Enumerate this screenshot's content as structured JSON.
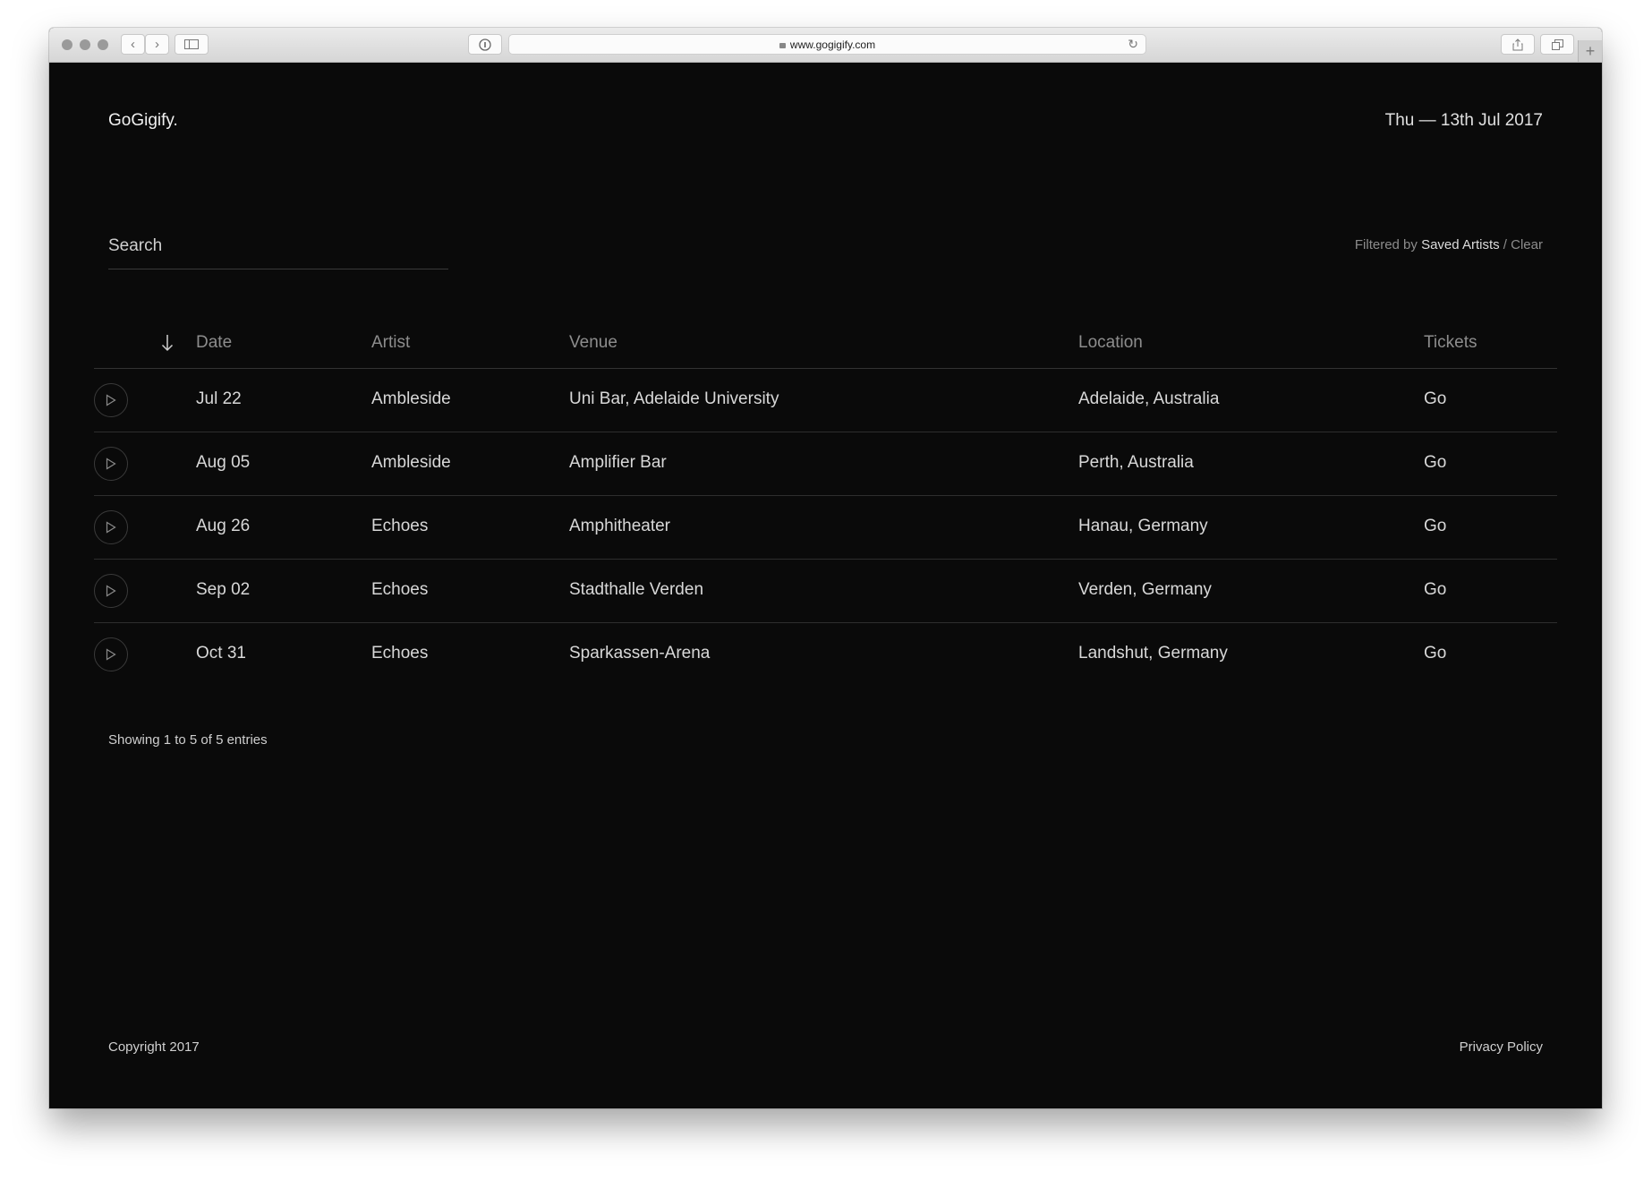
{
  "browser": {
    "url": "www.gogigify.com"
  },
  "header": {
    "logo": "GoGigify.",
    "date": "Thu — 13th Jul 2017"
  },
  "search": {
    "placeholder": "Search"
  },
  "filter": {
    "prefix": "Filtered by",
    "value": "Saved Artists",
    "separator": "/",
    "clear": "Clear"
  },
  "table": {
    "columns": {
      "date": "Date",
      "artist": "Artist",
      "venue": "Venue",
      "location": "Location",
      "tickets": "Tickets"
    },
    "rows": [
      {
        "date": "Jul 22",
        "artist": "Ambleside",
        "venue": "Uni Bar, Adelaide University",
        "location": "Adelaide, Australia",
        "tickets": "Go"
      },
      {
        "date": "Aug 05",
        "artist": "Ambleside",
        "venue": "Amplifier Bar",
        "location": "Perth, Australia",
        "tickets": "Go"
      },
      {
        "date": "Aug 26",
        "artist": "Echoes",
        "venue": "Amphitheater",
        "location": "Hanau, Germany",
        "tickets": "Go"
      },
      {
        "date": "Sep 02",
        "artist": "Echoes",
        "venue": "Stadthalle Verden",
        "location": "Verden, Germany",
        "tickets": "Go"
      },
      {
        "date": "Oct 31",
        "artist": "Echoes",
        "venue": "Sparkassen-Arena",
        "location": "Landshut, Germany",
        "tickets": "Go"
      }
    ]
  },
  "status": {
    "showing": "Showing 1 to 5 of 5 entries"
  },
  "footer": {
    "copyright": "Copyright 2017",
    "privacy": "Privacy Policy"
  },
  "icons": {
    "play": "play-icon",
    "sort": "arrow-down-icon"
  },
  "colors": {
    "background": "#0a0a0a",
    "text": "#d8d8d8",
    "muted": "#8d8d8d"
  }
}
